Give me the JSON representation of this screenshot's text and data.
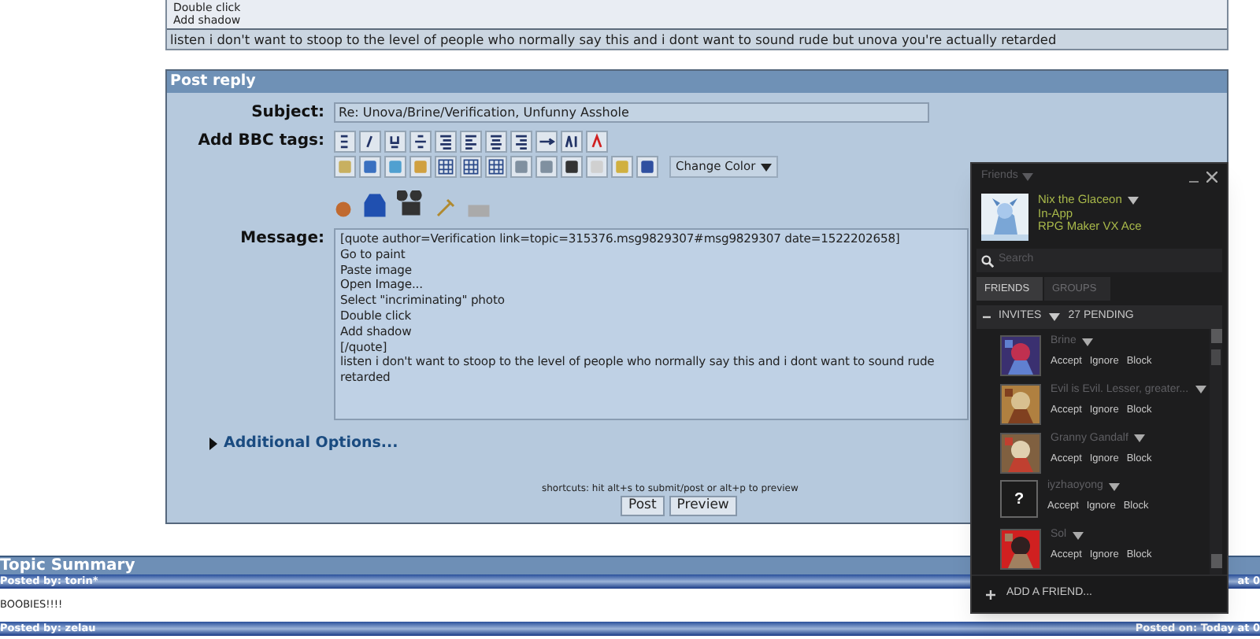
{
  "quote": {
    "lines": [
      "Double click",
      "Add shadow"
    ],
    "reply": "listen i don't want to stoop to the level of people who normally say this and i dont want to sound rude but unova you're actually retarded"
  },
  "post_reply": {
    "title": "Post reply",
    "subject_label": "Subject:",
    "subject": "Re: Unova/Brine/Verification, Unfunny Asshole",
    "bbc_label": "Add BBC tags:",
    "color_select": "Change Color",
    "message_label": "Message:",
    "message": "[quote author=Verification link=topic=315376.msg9829307#msg9829307 date=1522202658]\nGo to paint\nPaste image\nOpen Image...\nSelect \"incriminating\" photo\nDouble click\nAdd shadow\n[/quote]\nlisten i don't want to stoop to the level of people who normally say this and i dont want to sound rude\nretarded",
    "additional_options": "Additional Options...",
    "shortcuts": "shortcuts: hit alt+s to submit/post or alt+p to preview",
    "buttons": [
      "Post",
      "Preview"
    ]
  },
  "topic_summary": {
    "title": "Topic Summary",
    "posts": [
      {
        "posted_by": "Posted by: torin*",
        "posted_on": "at 0",
        "body": "BOOBIES!!!!"
      },
      {
        "posted_by": "Posted by: zelau",
        "posted_on": "Posted on: Today at 0"
      }
    ]
  },
  "friends": {
    "title": "Friends",
    "user": {
      "name": "Nix the Glaceon",
      "status": "In-App",
      "game": "RPG Maker VX Ace"
    },
    "search": {
      "placeholder": "Search"
    },
    "tabs": [
      {
        "label": "FRIENDS",
        "selected": true
      },
      {
        "label": "GROUPS",
        "selected": false
      }
    ],
    "invites": {
      "label": "INVITES",
      "count": "27 PENDING",
      "expanded": true,
      "items": [
        {
          "name": "Brine",
          "kind": "picture",
          "actions": [
            "Accept",
            "Ignore",
            "Block"
          ]
        },
        {
          "name": "Evil is Evil. Lesser, greater...",
          "kind": "picture",
          "actions": [
            "Accept",
            "Ignore",
            "Block"
          ]
        },
        {
          "name": "Granny Gandalf",
          "kind": "picture",
          "actions": [
            "Accept",
            "Ignore",
            "Block"
          ]
        },
        {
          "name": "iyzhaoyong",
          "kind": "default",
          "avatar_text": "?",
          "actions": [
            "Accept",
            "Ignore",
            "Block"
          ]
        },
        {
          "name": "Sol",
          "kind": "picture",
          "actions": [
            "Accept",
            "Ignore",
            "Block"
          ]
        }
      ]
    },
    "add_friend": "ADD A FRIEND..."
  }
}
